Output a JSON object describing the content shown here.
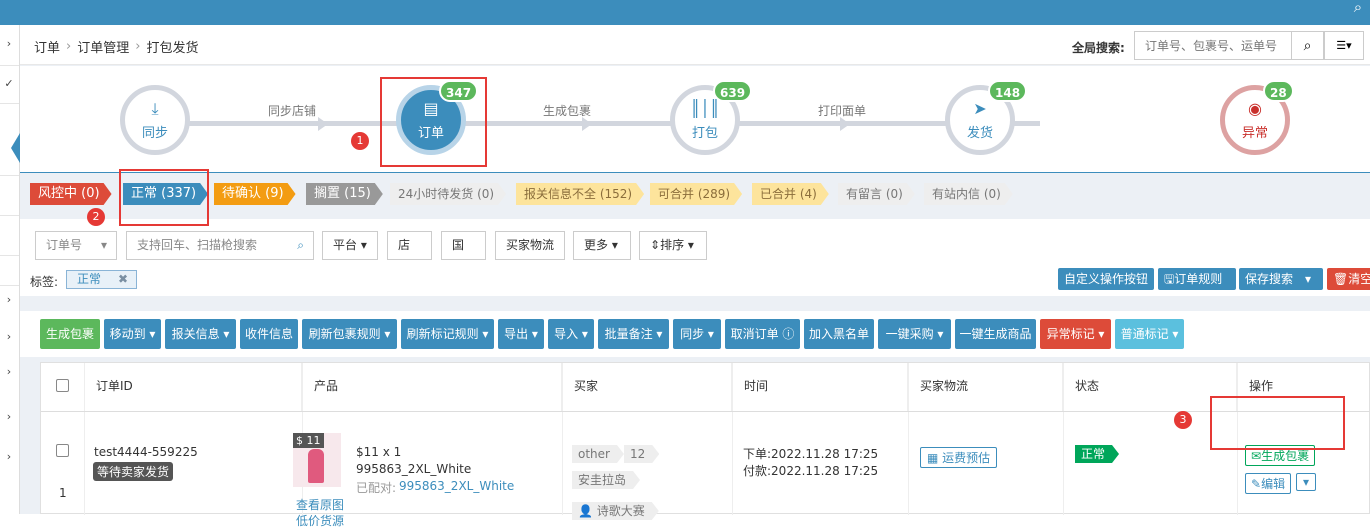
{
  "breadcrumb": [
    "订单",
    "订单管理",
    "打包发货"
  ],
  "global_search": {
    "label": "全局搜索:",
    "placeholder": "订单号、包裹号、运单号"
  },
  "flow": {
    "nodes": [
      {
        "label": "同步",
        "icon": "download-icon"
      },
      {
        "label": "订单",
        "icon": "order-list-icon",
        "count": "347"
      },
      {
        "label": "打包",
        "icon": "barcode-icon",
        "count": "639"
      },
      {
        "label": "发货",
        "icon": "paper-plane-icon",
        "count": "148"
      },
      {
        "label": "异常",
        "icon": "eye-slash-icon",
        "count": "28"
      }
    ],
    "connectors": [
      "同步店铺",
      "生成包裹",
      "打印面单"
    ]
  },
  "annotations": [
    "1",
    "2",
    "3"
  ],
  "status_tabs": [
    "风控中 (0)",
    "正常 (337)",
    "待确认 (9)",
    "搁置 (15)",
    "24小时待发货 (0)",
    "报关信息不全 (152)",
    "可合并 (289)",
    "已合并 (4)",
    "有留言 (0)",
    "有站内信 (0)"
  ],
  "filters": {
    "order_select": "订单号",
    "search_placeholder": "支持回车、扫描枪搜索",
    "buttons": [
      "平台",
      "店铺",
      "国家",
      "买家物流",
      "更多",
      "排序"
    ]
  },
  "tag_row": {
    "label": "标签:",
    "chip": "正常",
    "chip_close": "✖"
  },
  "right_buttons": [
    "自定义操作按钮",
    "订单规则",
    "保存搜索",
    "清空"
  ],
  "actions": [
    "生成包裹",
    "移动到",
    "报关信息",
    "收件信息",
    "刷新包裹规则",
    "刷新标记规则",
    "导出",
    "导入",
    "批量备注",
    "同步",
    "取消订单",
    "加入黑名单",
    "一键采购",
    "一键生成商品",
    "异常标记",
    "普通标记"
  ],
  "table": {
    "columns": [
      "订单ID",
      "产品",
      "买家",
      "时间",
      "买家物流",
      "状态",
      "操作"
    ],
    "row": {
      "order_id": "test4444-559225",
      "order_badge": "等待卖家发货",
      "index": "1",
      "price_tag": "$ 11",
      "price_qty": "$11 x 1",
      "sku": "995863_2XL_White",
      "paired_label": "已配对:",
      "paired_sku": "995863_2XL_White",
      "view_image": "查看原图",
      "low_price": "低价货源",
      "buyer_tags": [
        "other",
        "12",
        "安圭拉岛",
        "诗歌大赛"
      ],
      "order_time": "下单:2022.11.28 17:25",
      "pay_time": "付款:2022.11.28 17:25",
      "shipping_estimate": "运费预估",
      "status": "正常",
      "op_generate": "生成包裹",
      "op_edit": "编辑"
    }
  },
  "colors": {
    "primary": "#3c8dbc",
    "danger": "#dd4b39",
    "success": "#00a65a",
    "warning": "#f39c12",
    "gray": "#999999",
    "annotation": "#e53935"
  }
}
